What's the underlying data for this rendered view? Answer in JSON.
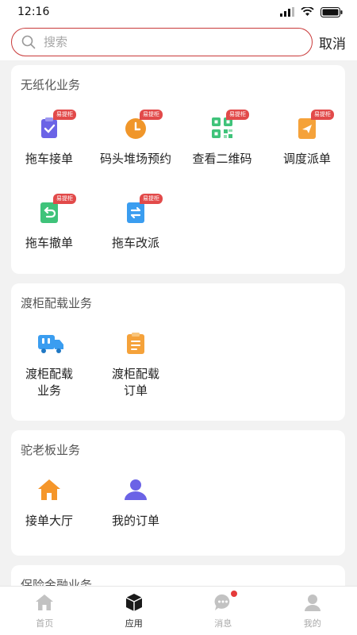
{
  "status": {
    "time": "12:16"
  },
  "search": {
    "placeholder": "搜索",
    "value": "",
    "cancel_label": "取消"
  },
  "sections": [
    {
      "title": "无纸化业务",
      "items": [
        {
          "label": "拖车接单",
          "badge": "易提柜",
          "icon": "clipboard-check-icon",
          "color": "#6b63e6"
        },
        {
          "label": "码头堆场预约",
          "badge": "易提柜",
          "icon": "clock-icon",
          "color": "#f0962a"
        },
        {
          "label": "查看二维码",
          "badge": "易提柜",
          "icon": "qr-code-icon",
          "color": "#3fc37a"
        },
        {
          "label": "调度派单",
          "badge": "易提柜",
          "icon": "paper-plane-icon",
          "color": "#f5a23a"
        },
        {
          "label": "拖车撤单",
          "badge": "易提柜",
          "icon": "undo-document-icon",
          "color": "#3fc37a"
        },
        {
          "label": "拖车改派",
          "badge": "易提柜",
          "icon": "swap-document-icon",
          "color": "#3a9df0"
        }
      ]
    },
    {
      "title": "渡柜配载业务",
      "items": [
        {
          "label": "渡柜配载业务",
          "icon": "truck-icon",
          "color": "#3a9df0"
        },
        {
          "label": "渡柜配载订单",
          "icon": "order-list-icon",
          "color": "#f5a23a"
        }
      ]
    },
    {
      "title": "驼老板业务",
      "items": [
        {
          "label": "接单大厅",
          "icon": "home-icon",
          "color": "#f5962a"
        },
        {
          "label": "我的订单",
          "icon": "user-icon",
          "color": "#6b63e6"
        }
      ]
    },
    {
      "title": "保险金融业务",
      "items": []
    }
  ],
  "tabs": [
    {
      "label": "首页",
      "icon": "home-tab-icon",
      "active": false
    },
    {
      "label": "应用",
      "icon": "cube-tab-icon",
      "active": true
    },
    {
      "label": "消息",
      "icon": "message-tab-icon",
      "active": false,
      "dot": true
    },
    {
      "label": "我的",
      "icon": "profile-tab-icon",
      "active": false
    }
  ]
}
